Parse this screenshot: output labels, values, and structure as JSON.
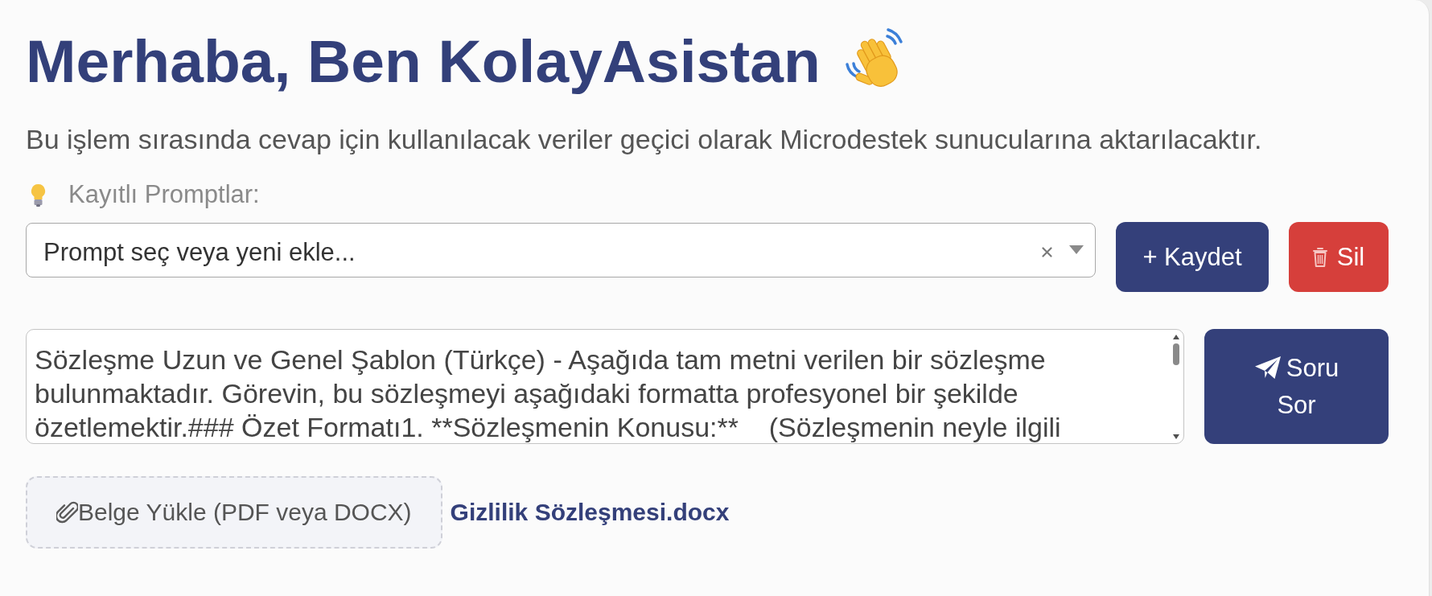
{
  "header": {
    "title": "Merhaba, Ben KolayAsistan",
    "notice": "Bu işlem sırasında cevap için kullanılacak veriler geçici olarak Microdestek sunucularına aktarılacaktır."
  },
  "saved_prompts": {
    "label": "Kayıtlı Promptlar:",
    "select": {
      "placeholder": "Prompt seç veya yeni ekle..."
    },
    "buttons": [
      {
        "kind": "save",
        "label": "+ Kaydet"
      },
      {
        "kind": "delete",
        "label": "Sil"
      }
    ]
  },
  "question": {
    "value": "Sözleşme Uzun ve Genel Şablon (Türkçe) - Aşağıda tam metni verilen bir sözleşme bulunmaktadır. Görevin, bu sözleşmeyi aşağıdaki formatta profesyonel bir şekilde özetlemektir.### Özet Formatı1. **Sözleşmenin Konusu:**    (Sözleşmenin neyle ilgili",
    "button": "Soru Sor"
  },
  "upload": {
    "button": "Belge Yükle (PDF veya DOCX)",
    "file_name": "Gizlilik Sözleşmesi.docx"
  }
}
